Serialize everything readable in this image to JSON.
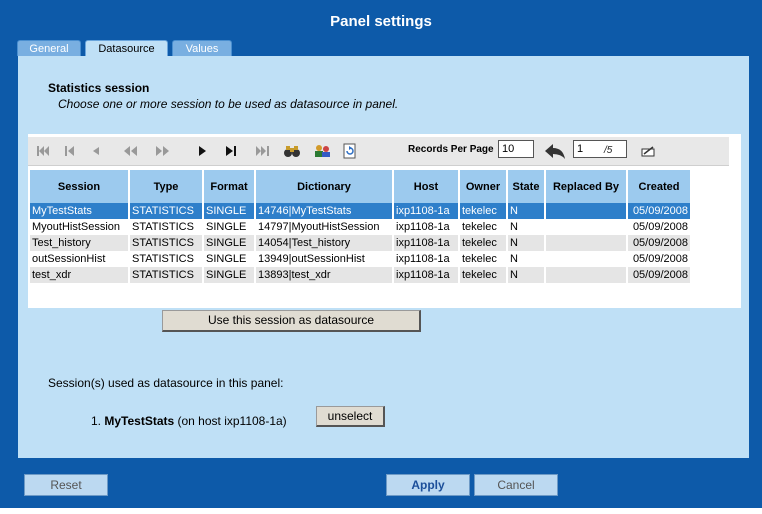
{
  "window": {
    "title": "Panel settings"
  },
  "tabs": [
    {
      "label": "General",
      "active": false
    },
    {
      "label": "Datasource",
      "active": true
    },
    {
      "label": "Values",
      "active": false
    }
  ],
  "section": {
    "title": "Statistics session",
    "subtitle": "Choose one or more session to be used as datasource in panel."
  },
  "toolbar": {
    "icons": [
      "first-page-icon",
      "prev-block-icon",
      "prev-icon",
      "rewind-icon",
      "fast-forward-icon",
      "next-icon",
      "last-icon",
      "last-page-icon",
      "binoculars-icon",
      "users-icon",
      "refresh-icon",
      "back-arrow-icon",
      "edit-icon"
    ],
    "records_per_page_label": "Records Per Page",
    "records_per_page_value": "10",
    "page_current": "1",
    "page_total": "/5"
  },
  "table": {
    "columns": [
      "Session",
      "Type",
      "Format",
      "Dictionary",
      "Host",
      "Owner",
      "State",
      "Replaced By",
      "Created"
    ],
    "rows": [
      [
        "MyTestStats",
        "STATISTICS",
        "SINGLE",
        "14746|MyTestStats",
        "ixp1108-1a",
        "tekelec",
        "N",
        "",
        "05/09/2008"
      ],
      [
        "MyoutHistSession",
        "STATISTICS",
        "SINGLE",
        "14797|MyoutHistSession",
        "ixp1108-1a",
        "tekelec",
        "N",
        "",
        "05/09/2008"
      ],
      [
        "Test_history",
        "STATISTICS",
        "SINGLE",
        "14054|Test_history",
        "ixp1108-1a",
        "tekelec",
        "N",
        "",
        "05/09/2008"
      ],
      [
        "outSessionHist",
        "STATISTICS",
        "SINGLE",
        "13949|outSessionHist",
        "ixp1108-1a",
        "tekelec",
        "N",
        "",
        "05/09/2008"
      ],
      [
        "test_xdr",
        "STATISTICS",
        "SINGLE",
        "13893|test_xdr",
        "ixp1108-1a",
        "tekelec",
        "N",
        "",
        "05/09/2008"
      ]
    ],
    "selected_row": 0
  },
  "use_button_label": "Use this session as datasource",
  "used": {
    "label": "Session(s) used as datasource in this panel:",
    "items": [
      {
        "index": "1.",
        "name": "MyTestStats",
        "host": "(on host ixp1108-1a)",
        "button": "unselect"
      }
    ]
  },
  "footer": {
    "reset": "Reset",
    "apply": "Apply",
    "cancel": "Cancel"
  },
  "colors": {
    "frame": "#0d5aa9",
    "panel": "#bfe0f6",
    "header": "#9ccaee",
    "selected": "#2e7fca"
  }
}
